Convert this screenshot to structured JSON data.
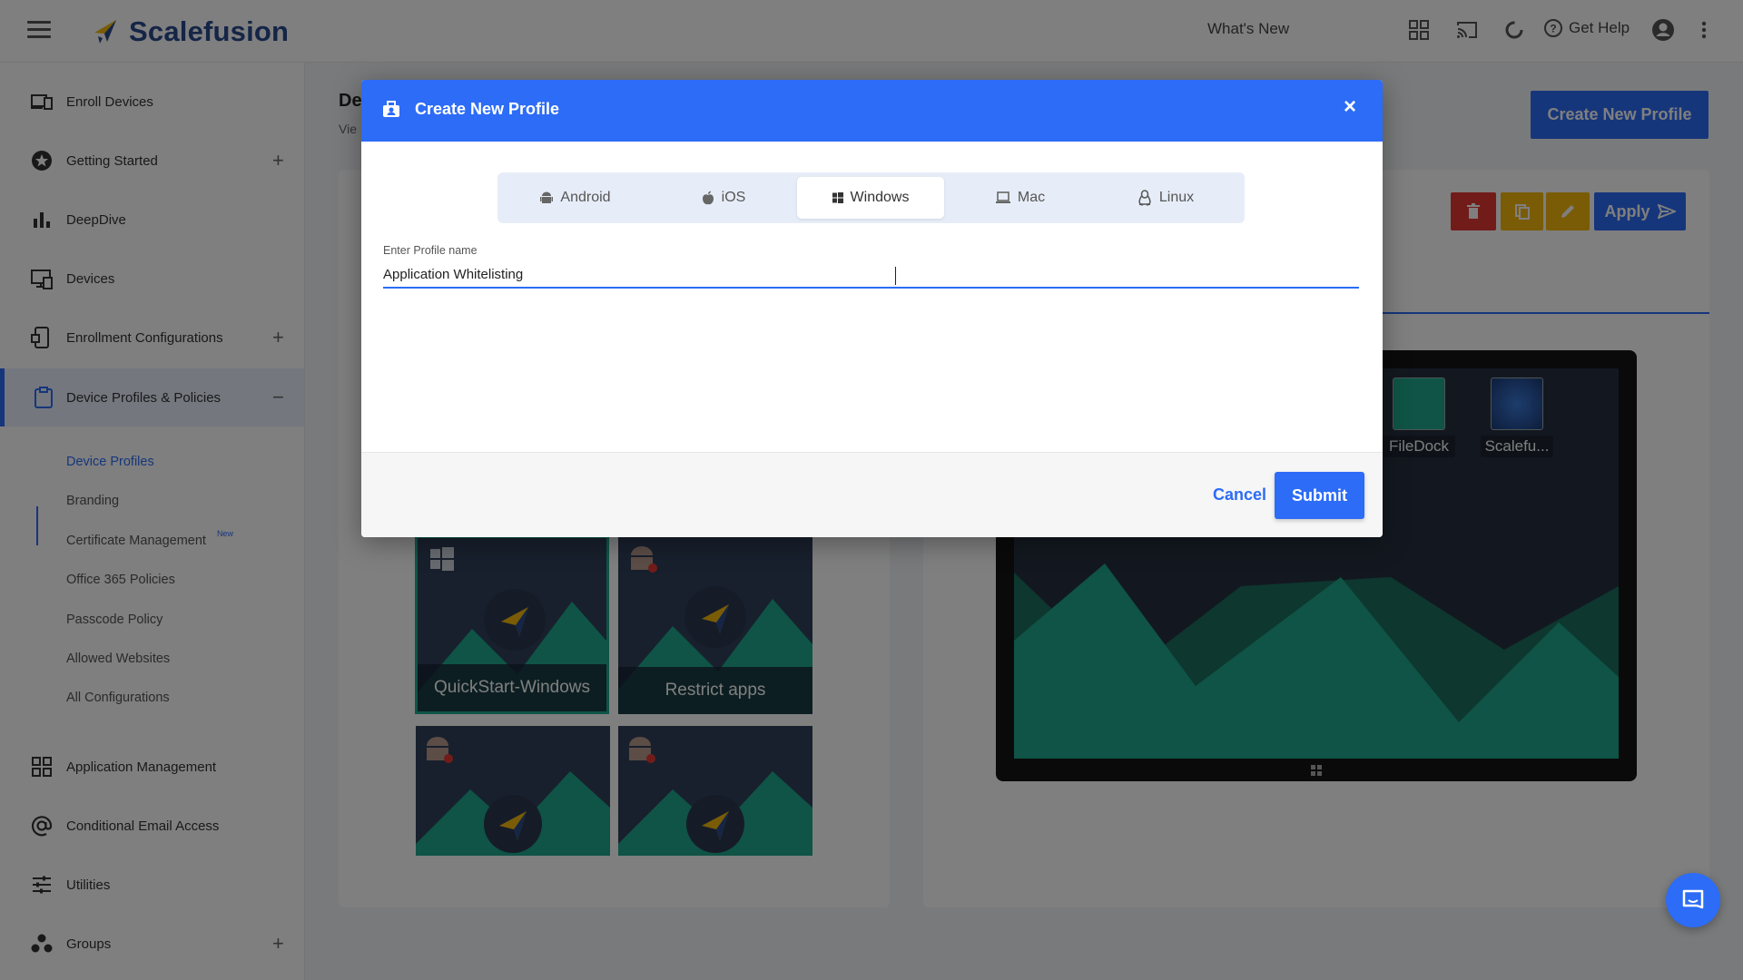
{
  "header": {
    "brand": "Scalefusion",
    "whats_new": "What's New",
    "get_help": "Get Help"
  },
  "sidebar": {
    "items": [
      {
        "label": "Enroll Devices",
        "icon": "enroll-devices-icon"
      },
      {
        "label": "Getting Started",
        "icon": "star-icon",
        "expandable": true
      },
      {
        "label": "DeepDive",
        "icon": "bar-chart-icon"
      },
      {
        "label": "Devices",
        "icon": "devices-icon"
      },
      {
        "label": "Enrollment Configurations",
        "icon": "enrollment-config-icon",
        "expandable": true
      },
      {
        "label": "Device Profiles & Policies",
        "icon": "clipboard-icon",
        "expanded": true
      },
      {
        "label": "Application Management",
        "icon": "grid-icon"
      },
      {
        "label": "Conditional Email Access",
        "icon": "at-icon"
      },
      {
        "label": "Utilities",
        "icon": "sliders-icon"
      },
      {
        "label": "Groups",
        "icon": "groups-icon",
        "expandable": true
      }
    ],
    "subitems": [
      {
        "label": "Device Profiles",
        "active": true
      },
      {
        "label": "Branding"
      },
      {
        "label": "Certificate Management",
        "badge": "New"
      },
      {
        "label": "Office 365 Policies"
      },
      {
        "label": "Passcode Policy"
      },
      {
        "label": "Allowed Websites"
      },
      {
        "label": "All Configurations"
      }
    ]
  },
  "main": {
    "title_partial": "De",
    "subtitle_partial": "Vie",
    "create_button": "Create New Profile",
    "apply_button": "Apply",
    "tiles": [
      {
        "label": "QuickStart-Windows",
        "os": "windows",
        "selected": true
      },
      {
        "label": "Restrict apps",
        "os": "android"
      },
      {
        "label": "",
        "os": "android"
      },
      {
        "label": "",
        "os": "android"
      }
    ],
    "desktop_icons": [
      {
        "label": "FileDock"
      },
      {
        "label": "Scalefu..."
      }
    ]
  },
  "modal": {
    "title": "Create New Profile",
    "os_tabs": [
      {
        "label": "Android",
        "icon": "android-icon"
      },
      {
        "label": "iOS",
        "icon": "apple-icon"
      },
      {
        "label": "Windows",
        "icon": "windows-icon",
        "active": true
      },
      {
        "label": "Mac",
        "icon": "laptop-icon"
      },
      {
        "label": "Linux",
        "icon": "linux-icon"
      }
    ],
    "field_label": "Enter Profile name",
    "field_value": "Application Whitelisting",
    "cancel": "Cancel",
    "submit": "Submit"
  },
  "colors": {
    "primary": "#2c6cf6",
    "brand_text": "#2a4a8f",
    "delete": "#e53935",
    "copy": "#f5b90f",
    "edit": "#f5b90f",
    "tile_bg": "#31405a",
    "mountain": "#1fa98c"
  }
}
